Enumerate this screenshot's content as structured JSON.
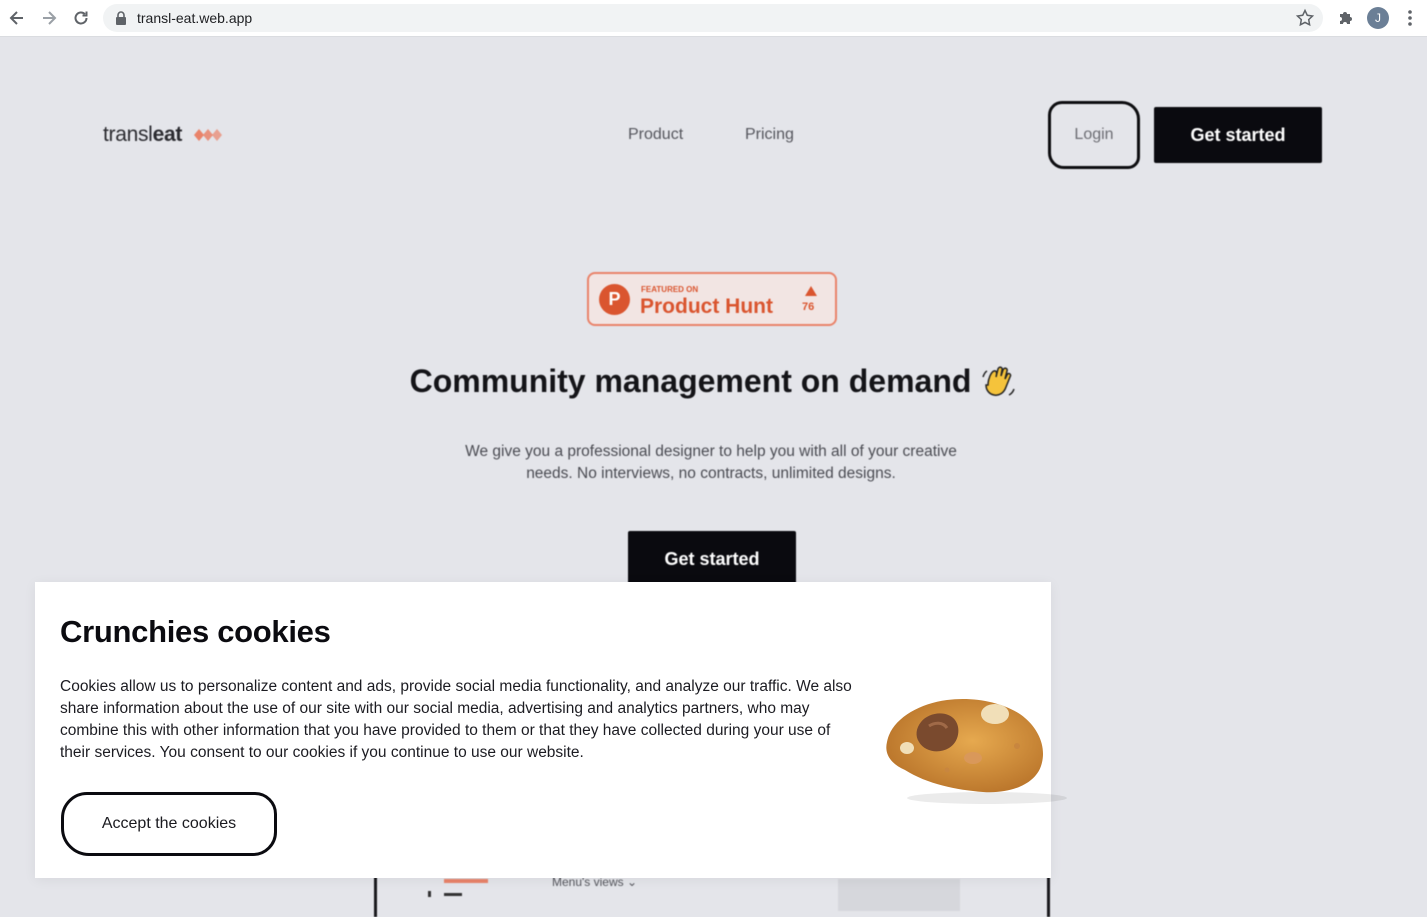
{
  "browser": {
    "url": "transl-eat.web.app",
    "profile_initial": "J"
  },
  "header": {
    "logo_text_light": "transl",
    "logo_text_bold": "eat",
    "nav": [
      {
        "label": "Product"
      },
      {
        "label": "Pricing"
      }
    ],
    "login_label": "Login",
    "get_started_label": "Get started"
  },
  "product_hunt": {
    "featured_label": "FEATURED ON",
    "name": "Product Hunt",
    "logo_letter": "P",
    "upvotes": "76"
  },
  "hero": {
    "title": "Community management on demand",
    "subtitle": "We give you a professional designer to help you with all of your creative needs. No interviews, no contracts, unlimited designs.",
    "cta_label": "Get started"
  },
  "preview": {
    "menu_views_label": "Menu's views ⌄"
  },
  "cookie_modal": {
    "title": "Crunchies cookies",
    "body": "Cookies allow us to personalize content and ads, provide social media functionality, and analyze our traffic. We also share information about the use of our site with our social media, advertising and analytics partners, who may combine this with other information that you have provided to them or that they have collected during your use of their services. You consent to our cookies if you continue to use our website.",
    "accept_label": "Accept the cookies"
  },
  "colors": {
    "page_bg": "#e4e5ea",
    "brand_orange": "#e9836a",
    "product_hunt": "#da552f",
    "cta_bg": "#0a0a0f"
  }
}
